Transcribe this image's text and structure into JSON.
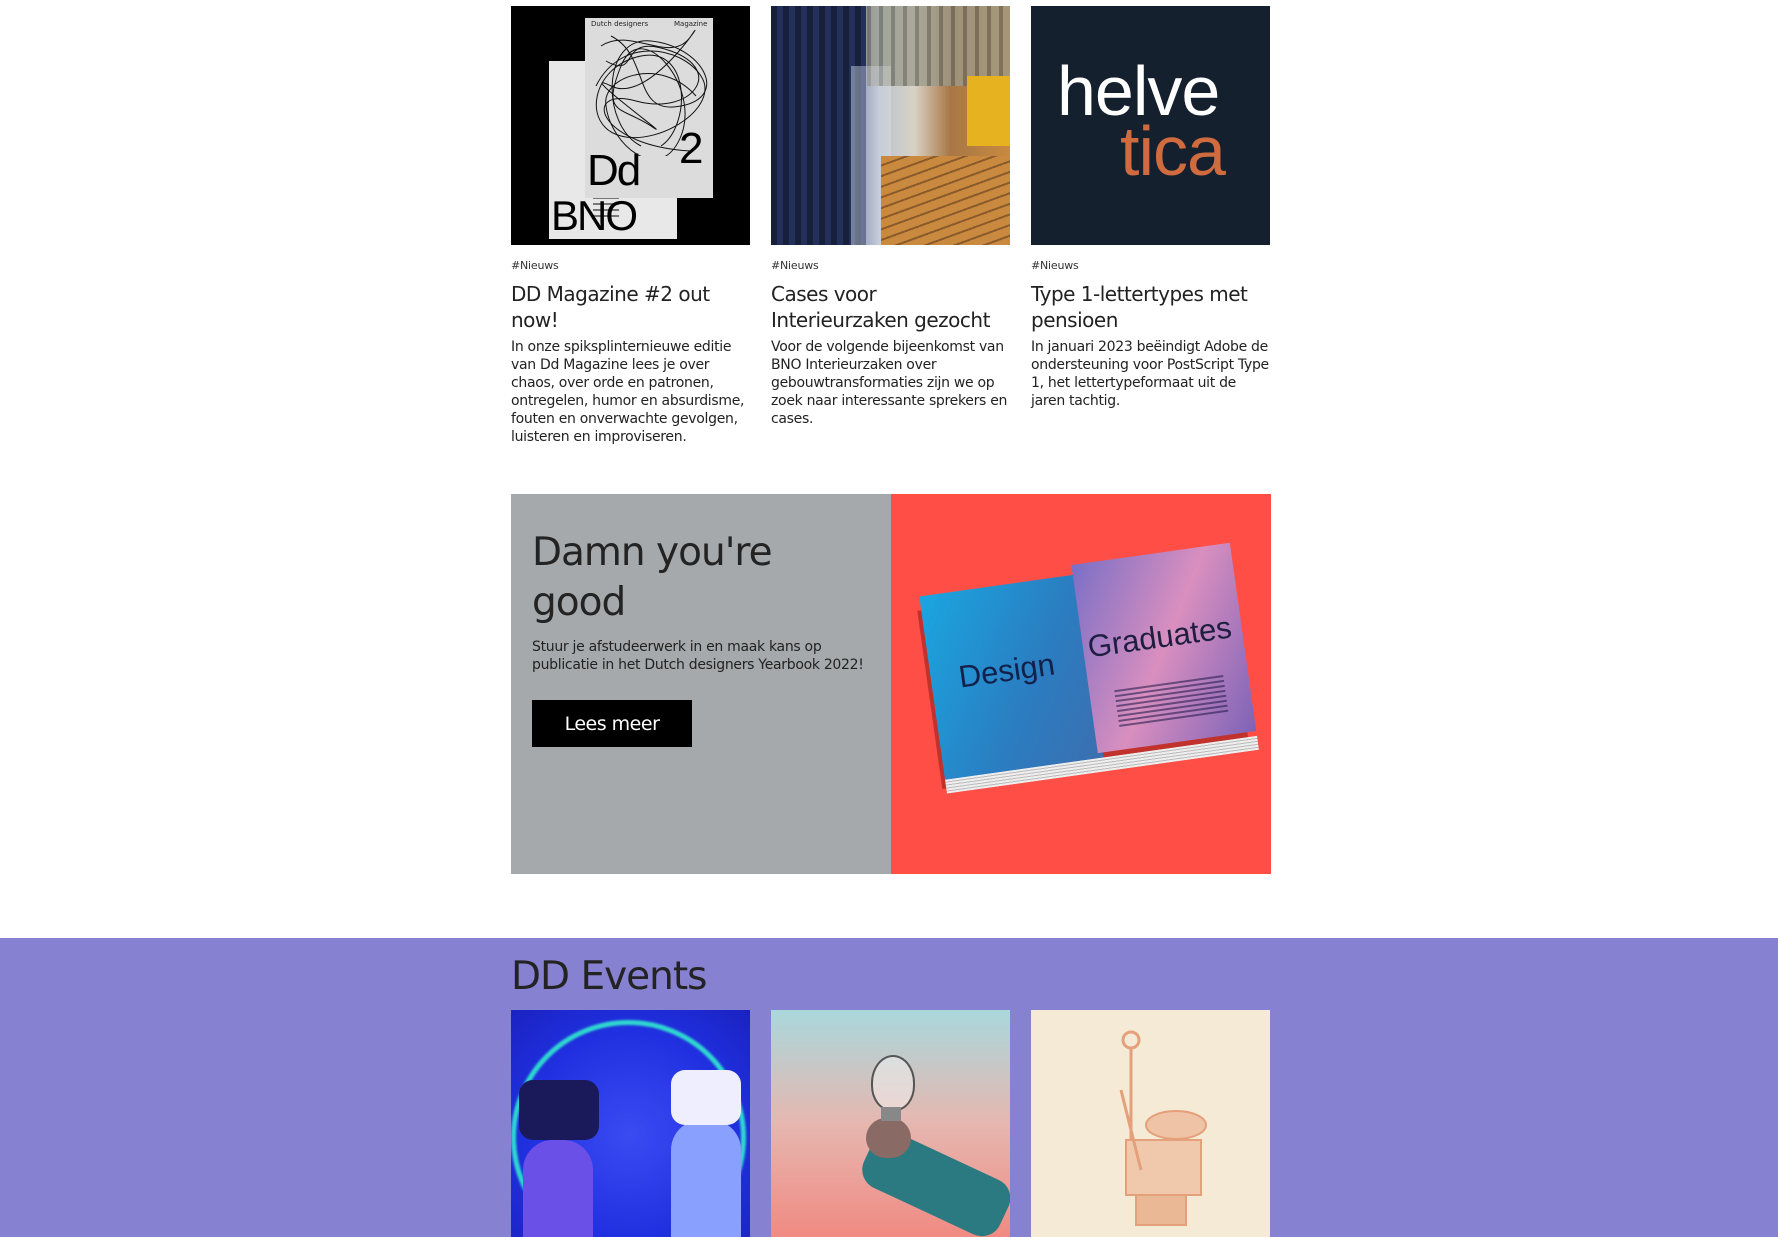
{
  "news": [
    {
      "tag": "#Nieuws",
      "title": "DD Magazine #2 out now!",
      "description": "In onze spiksplinternieuwe editie van Dd Magazine lees je over chaos, over orde en patronen, ontregelen, humor en absurdisme, fouten en onverwachte gevolgen, luisteren en improviseren.",
      "image_text": {
        "top_left": "Dutch designers",
        "top_right": "Magazine",
        "big1": "Dd",
        "big2": "2",
        "big3": "BNO"
      }
    },
    {
      "tag": "#Nieuws",
      "title": "Cases voor Interieurzaken gezocht",
      "description": "Voor de volgende bijeenkomst van BNO Interieurzaken over gebouwtransformaties zijn we op zoek naar interessante sprekers en cases."
    },
    {
      "tag": "#Nieuws",
      "title": "Type 1-lettertypes met pensioen",
      "description": "In januari 2023 beëindigt Adobe de ondersteuning voor PostScript Type 1, het lettertypeformaat uit de jaren tachtig.",
      "image_text": {
        "line1": "helve",
        "line2": "tica"
      }
    }
  ],
  "promo": {
    "title": "Damn you're good",
    "description": "Stuur je afstudeerwerk in en maak kans op publicatie in het Dutch designers Yearbook 2022!",
    "button": "Lees meer",
    "image_text": {
      "word1": "Design",
      "word2": "Graduates"
    }
  },
  "events": {
    "title": "DD Events"
  },
  "colors": {
    "promo_left": "#a6a9ab",
    "promo_right": "#ff4e46",
    "events_bg": "#8781d2",
    "helvetica_bg": "#15202f",
    "helvetica_accent": "#d06b3f"
  }
}
